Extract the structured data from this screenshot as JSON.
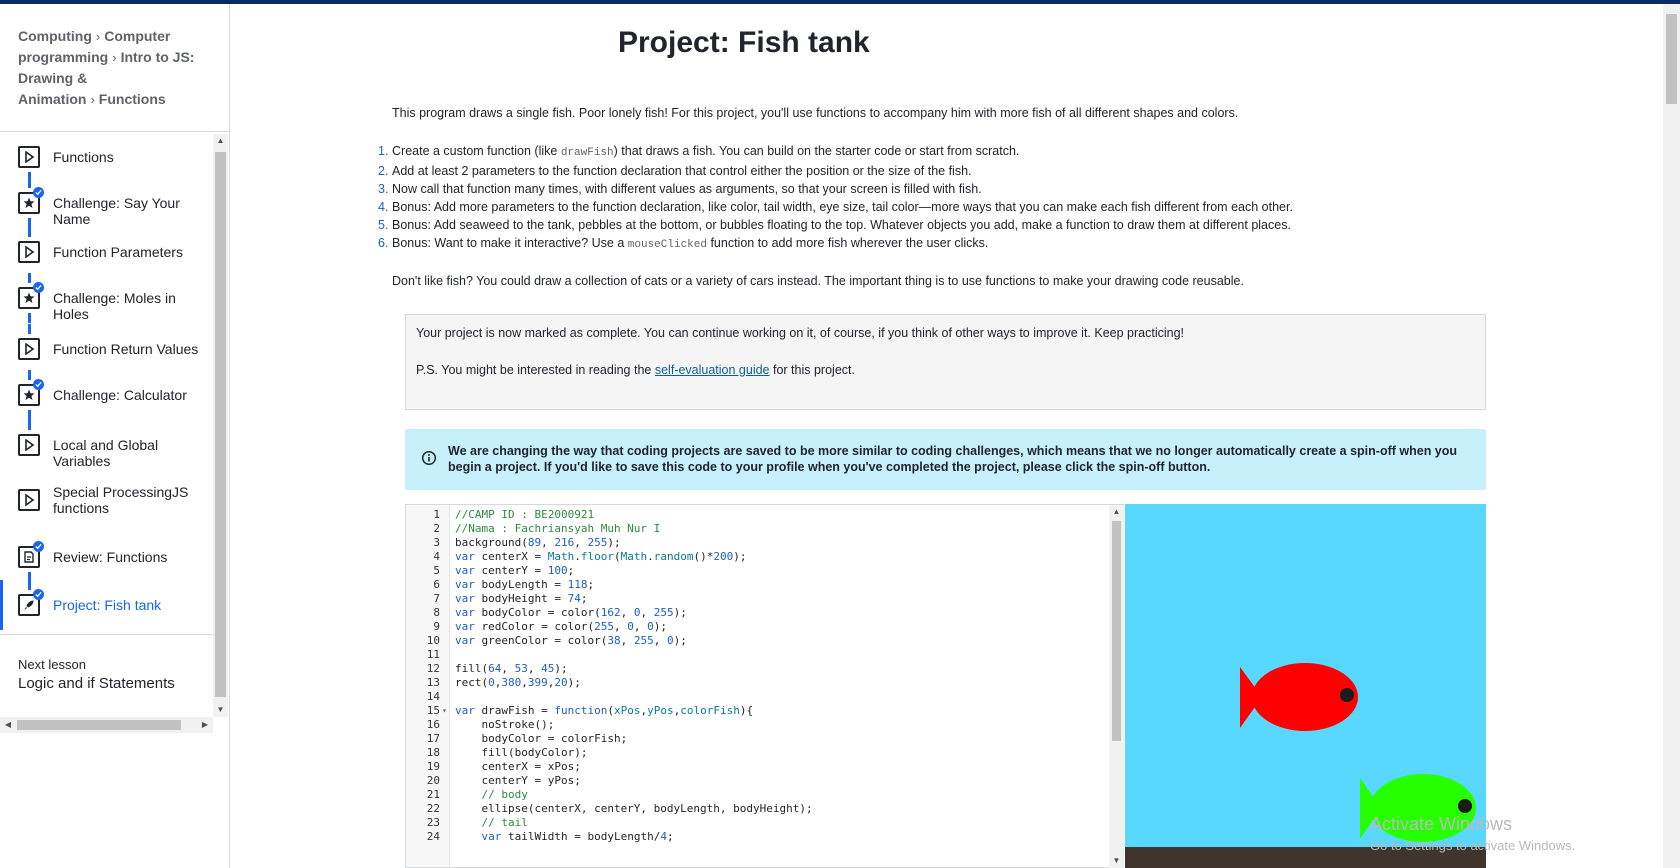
{
  "breadcrumb": {
    "items": [
      "Computing",
      "Computer programming",
      "Intro to JS: Drawing & Animation",
      "Functions"
    ],
    "separator": "›"
  },
  "sidebar": {
    "lessons": [
      {
        "label": "Functions",
        "icon": "play-icon",
        "done": false,
        "active": false
      },
      {
        "label": "Challenge: Say Your Name",
        "icon": "star-icon",
        "done": true,
        "active": false
      },
      {
        "label": "Function Parameters",
        "icon": "play-icon",
        "done": false,
        "active": false
      },
      {
        "label": "Challenge: Moles in Holes",
        "icon": "star-icon",
        "done": true,
        "active": false
      },
      {
        "label": "Function Return Values",
        "icon": "play-icon",
        "done": false,
        "active": false
      },
      {
        "label": "Challenge: Calculator",
        "icon": "star-icon",
        "done": true,
        "active": false
      },
      {
        "label": "Local and Global Variables",
        "icon": "play-icon",
        "done": false,
        "active": false
      },
      {
        "label": "Special ProcessingJS functions",
        "icon": "play-icon",
        "done": false,
        "active": false
      },
      {
        "label": "Review: Functions",
        "icon": "document-icon",
        "done": true,
        "active": false
      },
      {
        "label": "Project: Fish tank",
        "icon": "rocket-icon",
        "done": true,
        "active": true
      }
    ],
    "next_lesson_label": "Next lesson",
    "next_lesson_title": "Logic and if Statements"
  },
  "main": {
    "title": "Project: Fish tank",
    "intro": "This program draws a single fish. Poor lonely fish! For this project, you'll use functions to accompany him with more fish of all different shapes and colors.",
    "steps": [
      {
        "num": "1.",
        "before": "Create a custom function (like ",
        "code": "drawFish",
        "after": ") that draws a fish. You can build on the starter code or start from scratch."
      },
      {
        "num": "2.",
        "before": "Add at least 2 parameters to the function declaration that control either the position or the size of the fish.",
        "code": "",
        "after": ""
      },
      {
        "num": "3.",
        "before": "Now call that function many times, with different values as arguments, so that your screen is filled with fish.",
        "code": "",
        "after": ""
      },
      {
        "num": "4.",
        "before": "Bonus: Add more parameters to the function declaration, like color, tail width, eye size, tail color—more ways that you can make each fish different from each other.",
        "code": "",
        "after": ""
      },
      {
        "num": "5.",
        "before": "Bonus: Add seaweed to the tank, pebbles at the bottom, or bubbles floating to the top. Whatever objects you add, make a function to draw them at different places.",
        "code": "",
        "after": ""
      },
      {
        "num": "6.",
        "before": "Bonus: Want to make it interactive? Use a ",
        "code": "mouseClicked",
        "after": " function to add more fish wherever the user clicks."
      }
    ],
    "outro": "Don't like fish? You could draw a collection of cats or a variety of cars instead. The important thing is to use functions to make your drawing code reusable.",
    "complete_text": "Your project is now marked as complete. You can continue working on it, of course, if you think of other ways to improve it. Keep practicing!",
    "ps_before": "P.S. You might be interested in reading the ",
    "ps_link": "self-evaluation guide",
    "ps_after": " for this project.",
    "info_text": "We are changing the way that coding projects are saved to be more similar to coding challenges, which means that we no longer automatically create a spin-off when you begin a project. If you'd like to save this code to your profile when you've completed the project, please click the spin-off button."
  },
  "editor": {
    "lines": [
      "//CAMP ID : BE2000921",
      "//Nama : Fachriansyah Muh Nur I",
      "background(89, 216, 255);",
      "var centerX = Math.floor(Math.random()*200);",
      "var centerY = 100;",
      "var bodyLength = 118;",
      "var bodyHeight = 74;",
      "var bodyColor = color(162, 0, 255);",
      "var redColor = color(255, 0, 0);",
      "var greenColor = color(38, 255, 0);",
      "",
      "fill(64, 53, 45);",
      "rect(0,380,399,20);",
      "",
      "var drawFish = function(xPos,yPos,colorFish){",
      "    noStroke();",
      "    bodyColor = colorFish;",
      "    fill(bodyColor);",
      "    centerX = xPos;",
      "    centerY = yPos;",
      "    // body",
      "    ellipse(centerX, centerY, bodyLength, bodyHeight);",
      "    // tail",
      "    var tailWidth = bodyLength/4;"
    ]
  },
  "canvas": {
    "background": "#59d8ff",
    "ground": "#40352d",
    "fish": [
      {
        "color": "#ff0000",
        "eye": "#1b1b1b"
      },
      {
        "color": "#26ff00",
        "eye": "#1b1b1b"
      }
    ]
  },
  "watermark": {
    "line1": "Activate Windows",
    "line2": "Go to Settings to activate Windows."
  }
}
